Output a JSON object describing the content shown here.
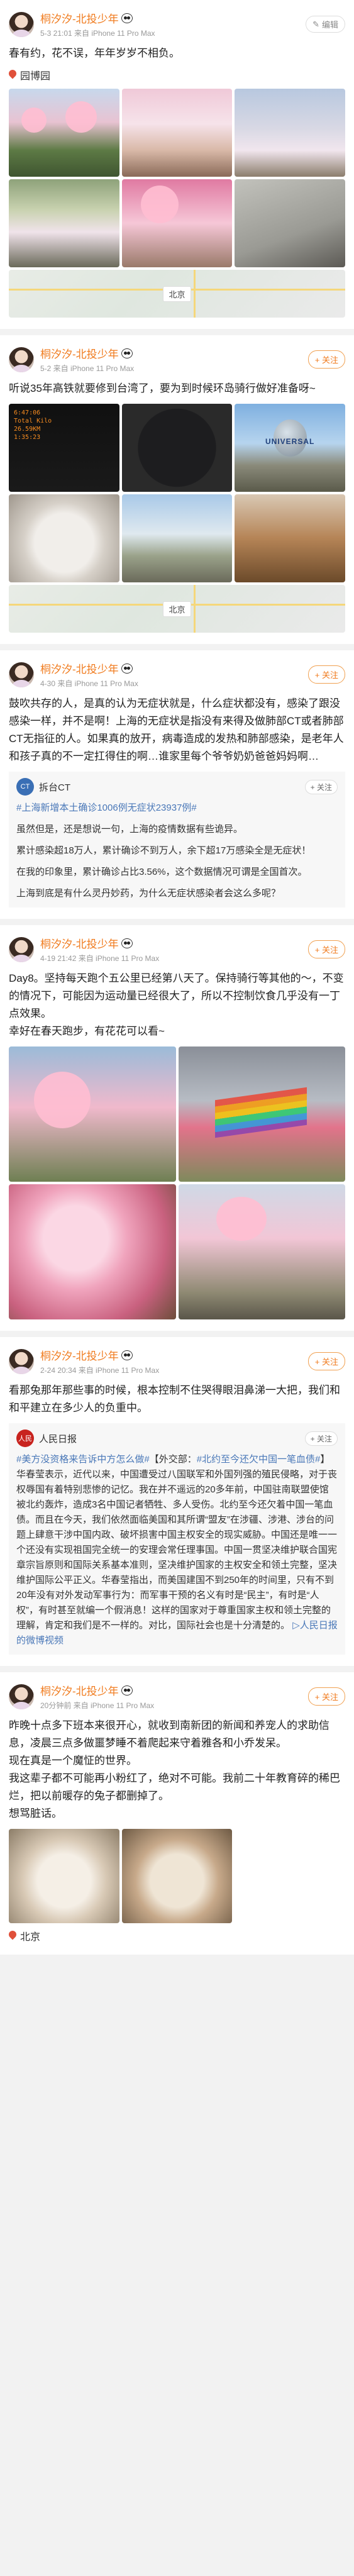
{
  "posts": [
    {
      "name": "桐汐汐-北投少年",
      "sub": "5-3 21:01 来自 iPhone 11 Pro Max",
      "action": "编辑",
      "text": "春有约，花不误，年年岁岁不相负。",
      "location": "园博园",
      "map_label": "北京"
    },
    {
      "name": "桐汐汐-北投少年",
      "sub": "5-2 来自 iPhone 11 Pro Max",
      "action": "+ 关注",
      "text": "听说35年高铁就要修到台湾了，要为到时候环岛骑行做好准备呀~",
      "watch_text": "6:47:06\nTotal Kilo\n26.59KM\n1:35:23",
      "univ_text": "UNIVERSAL",
      "map_label": "北京"
    },
    {
      "name": "桐汐汐-北投少年",
      "sub": "4-30 来自 iPhone 11 Pro Max",
      "action": "+ 关注",
      "text": "鼓吹共存的人，是真的认为无症状就是，什么症状都没有，感染了跟没感染一样，并不是啊！上海的无症状是指没有来得及做肺部CT或者肺部CT无指征的人。如果真的放开，病毒造成的发热和肺部感染，是老年人和孩子真的不一定扛得住的啊…谁家里每个爷爷奶奶爸爸妈妈啊…",
      "repost": {
        "name": "拆台CT",
        "follow": "+ 关注",
        "hashtag": "#上海新增本土确诊1006例无症状23937例#",
        "p1": "虽然但是，还是想说一句，上海的疫情数据有些诡异。",
        "p2": "累计感染超18万人，累计确诊不到万人，余下超17万感染全是无症状！",
        "p3": "在我的印象里，累计确诊占比3.56%，这个数据情况可谓是全国首次。",
        "p4": "上海到底是有什么灵丹妙药，为什么无症状感染者会这么多呢？"
      }
    },
    {
      "name": "桐汐汐-北投少年",
      "sub": "4-19 21:42 来自 iPhone 11 Pro Max",
      "action": "+ 关注",
      "text": "Day8。坚持每天跑个五公里已经第八天了。保持骑行等其他的～，不变的情况下，可能因为运动量已经很大了，所以不控制饮食几乎没有一丁点效果。\n幸好在春天跑步，有花花可以看~"
    },
    {
      "name": "桐汐汐-北投少年",
      "sub": "2-24 20:34 来自 iPhone 11 Pro Max",
      "action": "+ 关注",
      "text": "看那兔那年那些事的时候，根本控制不住哭得眼泪鼻涕一大把，我们和和平建立在多少人的负重中。",
      "repost": {
        "name": "人民日报",
        "follow": "+ 关注",
        "hashtag1": "#美方没资格来告诉中方怎么做#",
        "mid1": "【外交部：",
        "hashtag2": "#北约至今还欠中国一笔血债#",
        "body": "】华春莹表示，近代以来，中国遭受过八国联军和外国列强的殖民侵略，对于丧权辱国有着特别悲惨的记忆。我在并不遥远的20多年前，中国驻南联盟使馆被北约轰炸，造成3名中国记者牺牲、多人受伤。北约至今还欠着中国一笔血债。而且在今天，我们依然面临美国和其所谓“盟友”在涉疆、涉港、涉台的问题上肆意干涉中国内政、破坏损害中国主权安全的现实威胁。中国还是唯一一个还没有实现祖国完全统一的安理会常任理事国。中国一贯坚决维护联合国宪章宗旨原则和国际关系基本准则，坚决维护国家的主权安全和领土完整，坚决维护国际公平正义。华春莹指出，而美国建国不到250年的时间里，只有不到20年没有对外发动军事行为：而军事干预的名义有时是“民主”，有时是“人权”，有时甚至就编一个假消息！这样的国家对于尊重国家主权和领土完整的理解，肯定和我们是不一样的。对比，国际社会也是十分清楚的。",
        "link": "人民日报的微博视频"
      }
    },
    {
      "name": "桐汐汐-北投少年",
      "sub": "20分钟前 来自 iPhone 11 Pro Max",
      "action": "+ 关注",
      "text": "昨晚十点多下班本来很开心，就收到南新团的新闻和养宠人的求助信息，凌晨三点多做噩梦睡不着爬起来守着雅各和小乔发呆。\n现在真是一个魔怔的世界。\n我这辈子都不可能再小粉红了，绝对不可能。我前二十年教育碎的稀巴烂，把以前暖存的兔子都删掉了。\n想骂脏话。",
      "map_label": "北京"
    }
  ]
}
